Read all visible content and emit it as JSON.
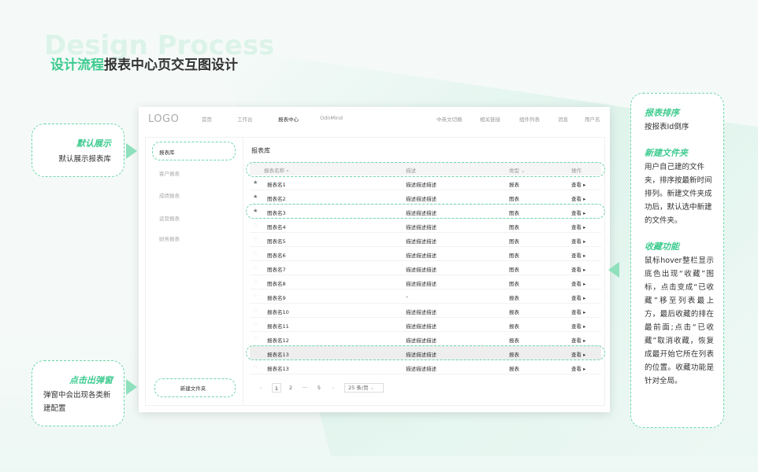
{
  "header": {
    "bg_word": "Design Process",
    "title_accent": "设计流程",
    "title_rest": "报表中心页交互图设计"
  },
  "app": {
    "logo": "LOGO",
    "nav": [
      "首页",
      "工作台",
      "报表中心",
      "OdnMind"
    ],
    "nav_right": [
      "中英文切换",
      "相关链接",
      "组件列表",
      "消息",
      "用户名"
    ],
    "sidebar": [
      "报表库",
      "客户报表",
      "成绩报表",
      "运营报表",
      "财务报表"
    ],
    "new_folder": "新建文件夹",
    "main_title": "报表库",
    "table_headers": {
      "name": "报表名称",
      "desc": "描述",
      "type": "类型",
      "op": "操作"
    },
    "rows": [
      {
        "star": "★",
        "name": "报表名1",
        "desc": "描述描述描述",
        "type": "报表",
        "op": "查看 ▸"
      },
      {
        "star": "★",
        "name": "图表名2",
        "desc": "描述描述描述",
        "type": "图表",
        "op": "查看 ▸"
      },
      {
        "star": "★",
        "name": "图表名3",
        "desc": "描述描述描述",
        "type": "图表",
        "op": "查看 ▸"
      },
      {
        "star": "☆",
        "name": "图表名4",
        "desc": "描述描述描述",
        "type": "图表",
        "op": "查看 ▸"
      },
      {
        "star": "☆",
        "name": "图表名5",
        "desc": "描述描述描述",
        "type": "图表",
        "op": "查看 ▸"
      },
      {
        "star": "☆",
        "name": "图表名6",
        "desc": "描述描述描述",
        "type": "图表",
        "op": "查看 ▸"
      },
      {
        "star": "☆",
        "name": "图表名7",
        "desc": "描述描述描述",
        "type": "图表",
        "op": "查看 ▸"
      },
      {
        "star": "☆",
        "name": "图表名8",
        "desc": "描述描述描述",
        "type": "图表",
        "op": "查看 ▸"
      },
      {
        "star": "☆",
        "name": "报表名9",
        "desc": "–",
        "type": "报表",
        "op": "查看 ▸"
      },
      {
        "star": "☆",
        "name": "报表名10",
        "desc": "描述描述描述",
        "type": "报表",
        "op": "查看 ▸"
      },
      {
        "star": "☆",
        "name": "报表名11",
        "desc": "描述描述描述",
        "type": "报表",
        "op": "查看 ▸"
      },
      {
        "star": "☆",
        "name": "报表名12",
        "desc": "描述描述描述",
        "type": "报表",
        "op": "查看 ▸"
      },
      {
        "star": "☆",
        "name": "报表名13",
        "desc": "描述描述描述",
        "type": "报表",
        "op": "查看 ▸"
      },
      {
        "star": "☆",
        "name": "报表名13",
        "desc": "描述描述描述",
        "type": "报表",
        "op": "查看 ▸"
      }
    ],
    "pager": {
      "prev": "‹",
      "p1": "1",
      "p2": "2",
      "ellipsis": "···",
      "p5": "5",
      "next": "›",
      "size": "25 条/页"
    }
  },
  "callouts": {
    "default": {
      "title": "默认展示",
      "text": "默认展示报表库"
    },
    "popup": {
      "title": "点击出弹窗",
      "text": "弹窗中会出现各类新建配置"
    },
    "sort": {
      "title": "报表排序",
      "text": "按报表Id倒序"
    },
    "folder": {
      "title": "新建文件夹",
      "text": "用户自己建的文件夹，排序按最新时间排列。新建文件夹成功后，默认选中新建的文件夹。"
    },
    "fav": {
      "title": "收藏功能",
      "text": "鼠标hover整栏显示底色出现“收藏”图标，点击变成“已收藏”移至列表最上方，最后收藏的排在最前面;点击“已收藏”取消收藏，恢复成最开始它所在列表的位置。收藏功能是针对全局。"
    }
  },
  "colors": {
    "accent": "#3ecb8f",
    "dash": "#6fd7a8"
  }
}
